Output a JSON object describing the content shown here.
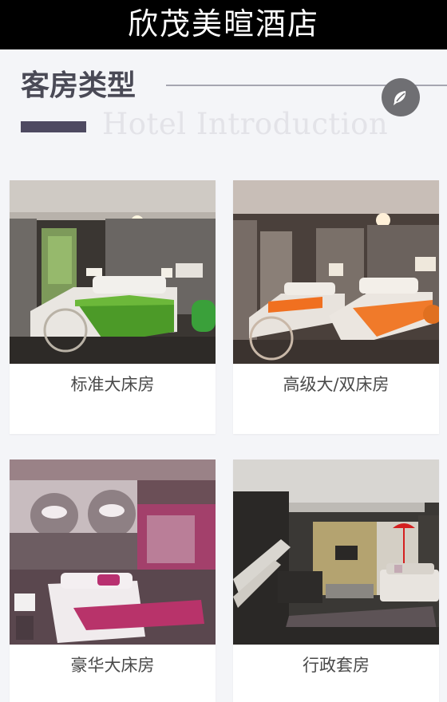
{
  "header": {
    "title": "欣茂美暄酒店"
  },
  "section": {
    "title": "客房类型",
    "subtitle": "Hotel Introduction",
    "icon": "chat-bubble-icon"
  },
  "rooms": [
    {
      "name": "标准大床房",
      "accent": "#5aa32a"
    },
    {
      "name": "高级大/双床房",
      "accent": "#f07a2a"
    },
    {
      "name": "豪华大床房",
      "accent": "#b8336a"
    },
    {
      "name": "行政套房",
      "accent": "#d42020"
    }
  ]
}
